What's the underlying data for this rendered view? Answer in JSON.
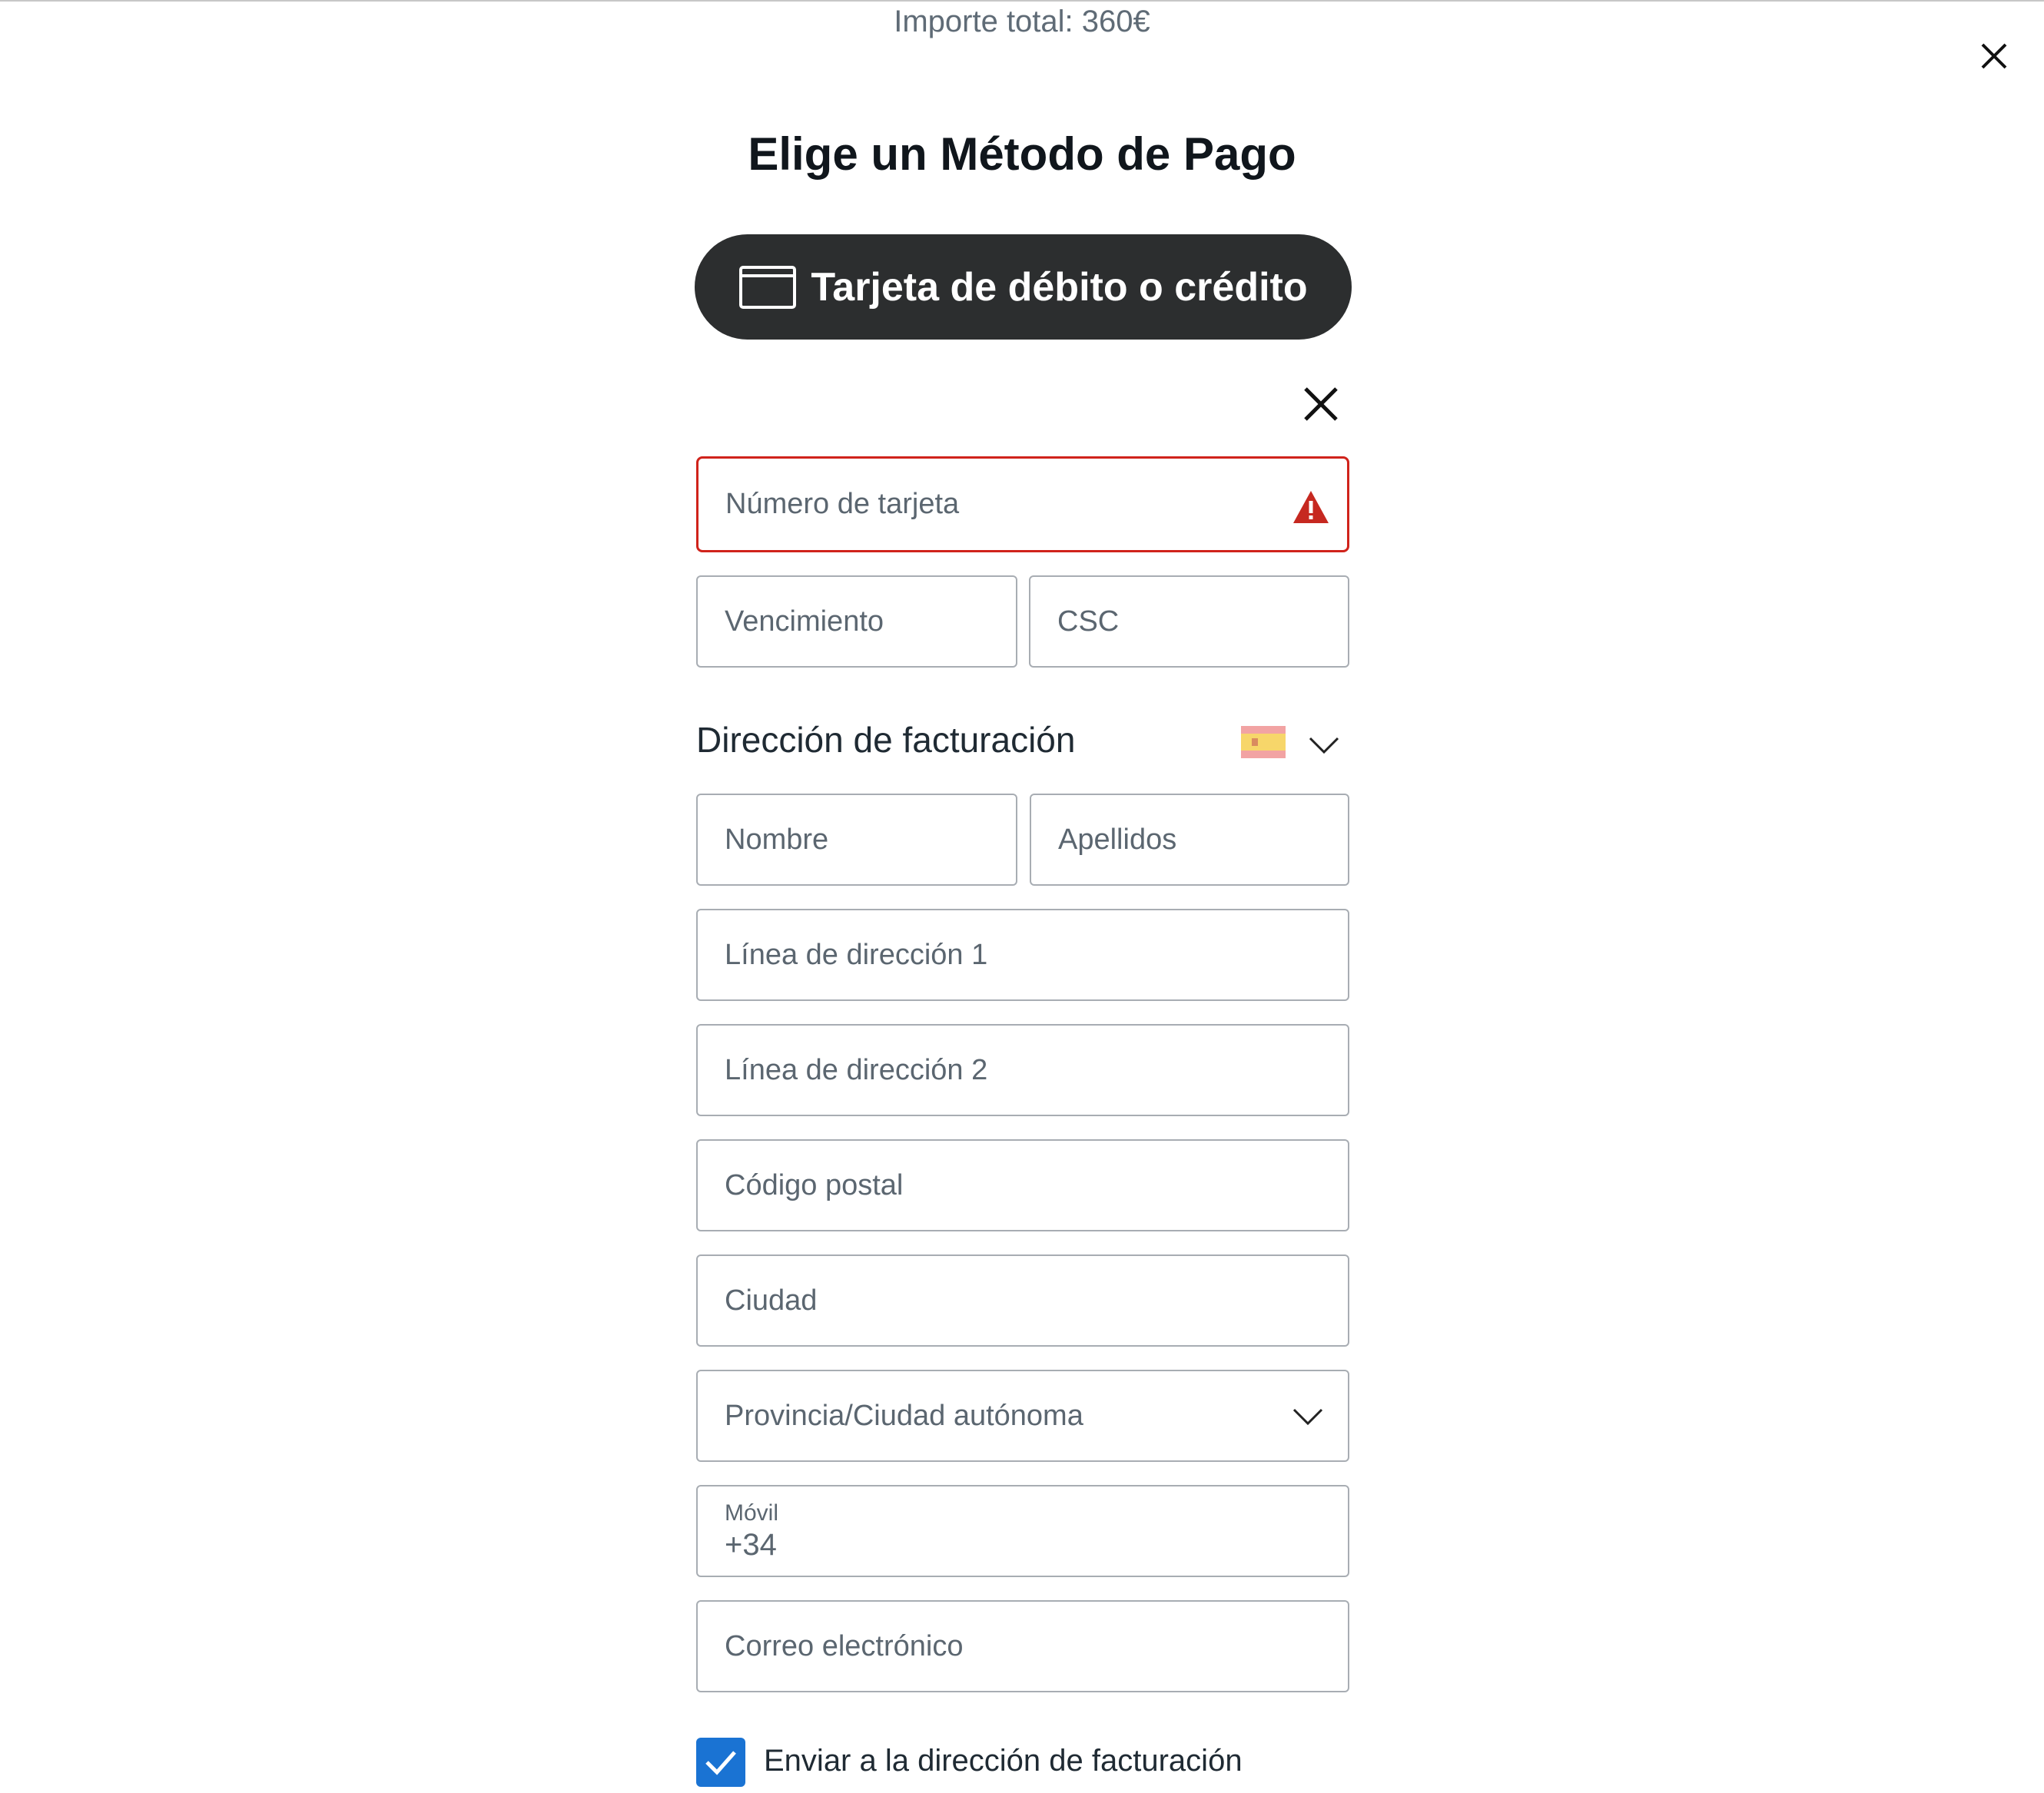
{
  "header": {
    "total_amount": "Importe total: 360€",
    "close_icon": "close-icon"
  },
  "title": "Elige un Método de Pago",
  "payment_method": {
    "label": "Tarjeta de débito o crédito",
    "icon": "credit-card-icon"
  },
  "card_form": {
    "close_icon": "close-icon",
    "card_number_placeholder": "Número de tarjeta",
    "card_number_status": "error",
    "error_color": "#d0231b",
    "expiry_placeholder": "Vencimiento",
    "csc_placeholder": "CSC"
  },
  "billing": {
    "section_label": "Dirección de facturación",
    "country_flag": "spain-flag-icon",
    "first_name_placeholder": "Nombre",
    "last_name_placeholder": "Apellidos",
    "address1_placeholder": "Línea de dirección 1",
    "address2_placeholder": "Línea de dirección 2",
    "postal_placeholder": "Código postal",
    "city_placeholder": "Ciudad",
    "province_placeholder": "Provincia/Ciudad autónoma",
    "phone_label": "Móvil",
    "phone_prefix": "+34",
    "email_placeholder": "Correo electrónico",
    "ship_same_checked": true,
    "ship_same_label": "Enviar a la dirección de facturación",
    "checkbox_color": "#1a73d3"
  },
  "colors": {
    "button_bg": "#2c2e2f",
    "field_border": "#a8adb3"
  }
}
